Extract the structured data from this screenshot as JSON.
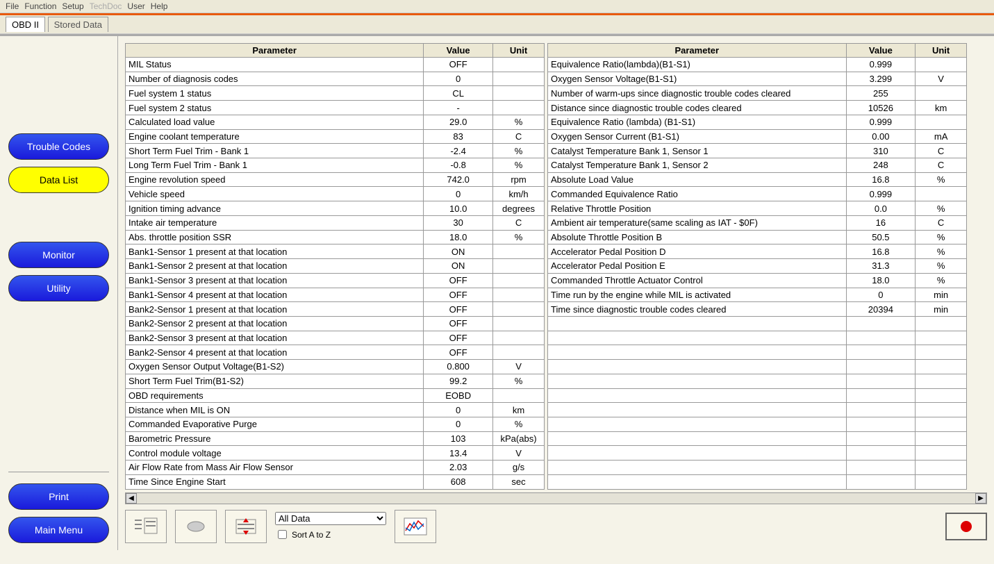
{
  "menubar": [
    "File",
    "Function",
    "Setup",
    "TechDoc",
    "User",
    "Help"
  ],
  "menubar_disabled_index": 3,
  "tabs": {
    "active": "OBD II",
    "inactive": "Stored Data"
  },
  "sidebar": {
    "trouble_codes": "Trouble Codes",
    "data_list": "Data List",
    "monitor": "Monitor",
    "utility": "Utility",
    "print": "Print",
    "main_menu": "Main Menu"
  },
  "headers": {
    "parameter": "Parameter",
    "value": "Value",
    "unit": "Unit"
  },
  "left_table": [
    {
      "p": "MIL Status",
      "v": "OFF",
      "u": ""
    },
    {
      "p": "Number of diagnosis codes",
      "v": "0",
      "u": ""
    },
    {
      "p": "Fuel system 1 status",
      "v": "CL",
      "u": ""
    },
    {
      "p": "Fuel system 2 status",
      "v": "-",
      "u": ""
    },
    {
      "p": "Calculated load value",
      "v": "29.0",
      "u": "%"
    },
    {
      "p": "Engine coolant temperature",
      "v": "83",
      "u": "C"
    },
    {
      "p": "Short Term Fuel Trim - Bank 1",
      "v": "-2.4",
      "u": "%"
    },
    {
      "p": "Long Term Fuel Trim - Bank 1",
      "v": "-0.8",
      "u": "%"
    },
    {
      "p": "Engine revolution speed",
      "v": "742.0",
      "u": "rpm"
    },
    {
      "p": "Vehicle speed",
      "v": "0",
      "u": "km/h"
    },
    {
      "p": "Ignition timing advance",
      "v": "10.0",
      "u": "degrees"
    },
    {
      "p": "Intake air temperature",
      "v": "30",
      "u": "C"
    },
    {
      "p": "Abs. throttle position SSR",
      "v": "18.0",
      "u": "%"
    },
    {
      "p": "Bank1-Sensor 1 present at that location",
      "v": "ON",
      "u": ""
    },
    {
      "p": "Bank1-Sensor 2 present at that location",
      "v": "ON",
      "u": ""
    },
    {
      "p": "Bank1-Sensor 3 present at that location",
      "v": "OFF",
      "u": ""
    },
    {
      "p": "Bank1-Sensor 4 present at that location",
      "v": "OFF",
      "u": ""
    },
    {
      "p": "Bank2-Sensor 1 present at that location",
      "v": "OFF",
      "u": ""
    },
    {
      "p": "Bank2-Sensor 2 present at that location",
      "v": "OFF",
      "u": ""
    },
    {
      "p": "Bank2-Sensor 3 present at that location",
      "v": "OFF",
      "u": ""
    },
    {
      "p": "Bank2-Sensor 4 present at that location",
      "v": "OFF",
      "u": ""
    },
    {
      "p": "Oxygen Sensor Output Voltage(B1-S2)",
      "v": "0.800",
      "u": "V"
    },
    {
      "p": "Short Term Fuel Trim(B1-S2)",
      "v": "99.2",
      "u": "%"
    },
    {
      "p": "OBD requirements",
      "v": "EOBD",
      "u": ""
    },
    {
      "p": "Distance when MIL is ON",
      "v": "0",
      "u": "km"
    },
    {
      "p": "Commanded Evaporative Purge",
      "v": "0",
      "u": "%"
    },
    {
      "p": "Barometric Pressure",
      "v": "103",
      "u": "kPa(abs)"
    },
    {
      "p": "Control module voltage",
      "v": "13.4",
      "u": "V"
    },
    {
      "p": "Air Flow Rate from Mass Air Flow Sensor",
      "v": "2.03",
      "u": "g/s"
    },
    {
      "p": "Time Since Engine Start",
      "v": "608",
      "u": "sec"
    }
  ],
  "right_table": [
    {
      "p": "Equivalence Ratio(lambda)(B1-S1)",
      "v": "0.999",
      "u": ""
    },
    {
      "p": "Oxygen Sensor Voltage(B1-S1)",
      "v": "3.299",
      "u": "V"
    },
    {
      "p": "Number of warm-ups since diagnostic trouble codes cleared",
      "v": "255",
      "u": ""
    },
    {
      "p": "Distance since diagnostic trouble codes cleared",
      "v": "10526",
      "u": "km"
    },
    {
      "p": "Equivalence Ratio (lambda) (B1-S1)",
      "v": "0.999",
      "u": ""
    },
    {
      "p": "Oxygen Sensor Current (B1-S1)",
      "v": "0.00",
      "u": "mA"
    },
    {
      "p": "Catalyst Temperature Bank 1, Sensor 1",
      "v": "310",
      "u": "C"
    },
    {
      "p": "Catalyst Temperature Bank 1, Sensor 2",
      "v": "248",
      "u": "C"
    },
    {
      "p": "Absolute Load Value",
      "v": "16.8",
      "u": "%"
    },
    {
      "p": "Commanded Equivalence Ratio",
      "v": "0.999",
      "u": ""
    },
    {
      "p": "Relative Throttle Position",
      "v": "0.0",
      "u": "%"
    },
    {
      "p": "Ambient air temperature(same scaling as IAT - $0F)",
      "v": "16",
      "u": "C"
    },
    {
      "p": "Absolute Throttle Position B",
      "v": "50.5",
      "u": "%"
    },
    {
      "p": "Accelerator Pedal Position D",
      "v": "16.8",
      "u": "%"
    },
    {
      "p": "Accelerator Pedal Position E",
      "v": "31.3",
      "u": "%"
    },
    {
      "p": "Commanded Throttle Actuator Control",
      "v": "18.0",
      "u": "%"
    },
    {
      "p": "Time run by the engine while MIL is activated",
      "v": "0",
      "u": "min"
    },
    {
      "p": "Time since diagnostic trouble codes cleared",
      "v": "20394",
      "u": "min"
    },
    {
      "p": "",
      "v": "",
      "u": ""
    },
    {
      "p": "",
      "v": "",
      "u": ""
    },
    {
      "p": "",
      "v": "",
      "u": ""
    },
    {
      "p": "",
      "v": "",
      "u": ""
    },
    {
      "p": "",
      "v": "",
      "u": ""
    },
    {
      "p": "",
      "v": "",
      "u": ""
    },
    {
      "p": "",
      "v": "",
      "u": ""
    },
    {
      "p": "",
      "v": "",
      "u": ""
    },
    {
      "p": "",
      "v": "",
      "u": ""
    },
    {
      "p": "",
      "v": "",
      "u": ""
    },
    {
      "p": "",
      "v": "",
      "u": ""
    },
    {
      "p": "",
      "v": "",
      "u": ""
    }
  ],
  "toolbar": {
    "dropdown_selected": "All Data",
    "sort_label": "Sort A to Z",
    "sort_checked": false
  }
}
